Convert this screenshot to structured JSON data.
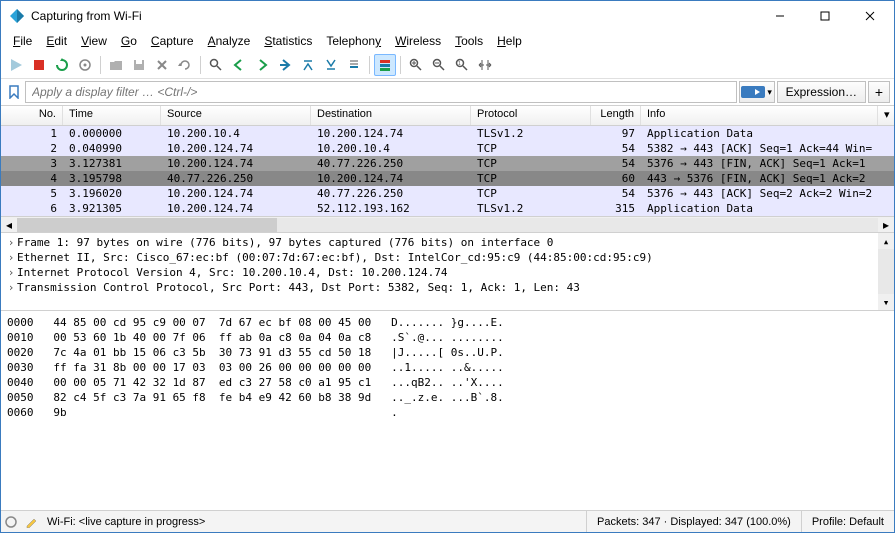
{
  "window": {
    "title": "Capturing from Wi-Fi"
  },
  "menu": {
    "file": "File",
    "edit": "Edit",
    "view": "View",
    "go": "Go",
    "capture": "Capture",
    "analyze": "Analyze",
    "statistics": "Statistics",
    "telephony": "Telephony",
    "wireless": "Wireless",
    "tools": "Tools",
    "help": "Help"
  },
  "filter": {
    "placeholder": "Apply a display filter … <Ctrl-/>",
    "expression_label": "Expression…"
  },
  "columns": {
    "no": "No.",
    "time": "Time",
    "source": "Source",
    "destination": "Destination",
    "protocol": "Protocol",
    "length": "Length",
    "info": "Info"
  },
  "packets": [
    {
      "no": "1",
      "time": "0.000000",
      "src": "10.200.10.4",
      "dst": "10.200.124.74",
      "proto": "TLSv1.2",
      "len": "97",
      "info": "Application Data",
      "style": "sel"
    },
    {
      "no": "2",
      "time": "0.040990",
      "src": "10.200.124.74",
      "dst": "10.200.10.4",
      "proto": "TCP",
      "len": "54",
      "info": "5382 → 443 [ACK] Seq=1 Ack=44 Win=",
      "style": "tcp"
    },
    {
      "no": "3",
      "time": "3.127381",
      "src": "10.200.124.74",
      "dst": "40.77.226.250",
      "proto": "TCP",
      "len": "54",
      "info": "5376 → 443 [FIN, ACK] Seq=1 Ack=1",
      "style": "dark"
    },
    {
      "no": "4",
      "time": "3.195798",
      "src": "40.77.226.250",
      "dst": "10.200.124.74",
      "proto": "TCP",
      "len": "60",
      "info": "443 → 5376 [FIN, ACK] Seq=1 Ack=2",
      "style": "dark2"
    },
    {
      "no": "5",
      "time": "3.196020",
      "src": "10.200.124.74",
      "dst": "40.77.226.250",
      "proto": "TCP",
      "len": "54",
      "info": "5376 → 443 [ACK] Seq=2 Ack=2 Win=2",
      "style": "tcp"
    },
    {
      "no": "6",
      "time": "3.921305",
      "src": "10.200.124.74",
      "dst": "52.112.193.162",
      "proto": "TLSv1.2",
      "len": "315",
      "info": "Application Data",
      "style": "tcp"
    }
  ],
  "tree": {
    "l0": "Frame 1: 97 bytes on wire (776 bits), 97 bytes captured (776 bits) on interface 0",
    "l1": "Ethernet II, Src: Cisco_67:ec:bf (00:07:7d:67:ec:bf), Dst: IntelCor_cd:95:c9 (44:85:00:cd:95:c9)",
    "l2": "Internet Protocol Version 4, Src: 10.200.10.4, Dst: 10.200.124.74",
    "l3": "Transmission Control Protocol, Src Port: 443, Dst Port: 5382, Seq: 1, Ack: 1, Len: 43"
  },
  "hex": {
    "l0": "0000   44 85 00 cd 95 c9 00 07  7d 67 ec bf 08 00 45 00   D....... }g....E.",
    "l1": "0010   00 53 60 1b 40 00 7f 06  ff ab 0a c8 0a 04 0a c8   .S`.@... ........",
    "l2": "0020   7c 4a 01 bb 15 06 c3 5b  30 73 91 d3 55 cd 50 18   |J.....[ 0s..U.P.",
    "l3": "0030   ff fa 31 8b 00 00 17 03  03 00 26 00 00 00 00 00   ..1..... ..&.....",
    "l4": "0040   00 00 05 71 42 32 1d 87  ed c3 27 58 c0 a1 95 c1   ...qB2.. ..'X....",
    "l5": "0050   82 c4 5f c3 7a 91 65 f8  fe b4 e9 42 60 b8 38 9d   .._.z.e. ...B`.8.",
    "l6": "0060   9b                                                 ."
  },
  "status": {
    "left": "Wi-Fi: <live capture in progress>",
    "packets": "Packets: 347 · Displayed: 347 (100.0%)",
    "profile": "Profile: Default"
  }
}
